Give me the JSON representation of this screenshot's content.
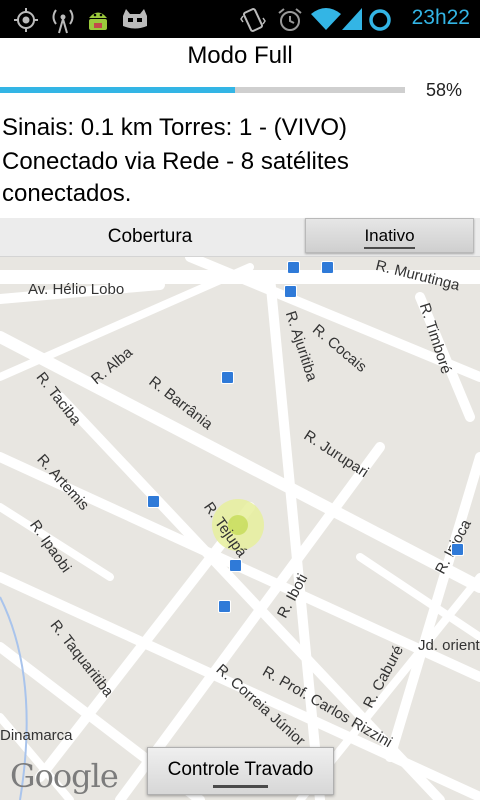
{
  "status_bar": {
    "time": "23h22",
    "left_icons": [
      "gps-icon",
      "radio-icon",
      "android-debug-icon",
      "cyanogen-icon"
    ],
    "right_icons": [
      "vibrate-icon",
      "alarm-icon",
      "wifi-icon",
      "signal-icon",
      "battery-ring-icon"
    ],
    "accent_color": "#33b5e5"
  },
  "header": {
    "title": "Modo Full",
    "progress_text": "58%",
    "progress_value": 0.58
  },
  "info": {
    "signals": "Sinais: 0.1 km Torres: 1 - (VIVO)",
    "connected": "Conectado via Rede - 8 satélites conectados."
  },
  "tabs": {
    "cobertura": "Cobertura",
    "inativo": "Inativo"
  },
  "map": {
    "streets": [
      "Av. Hélio Lobo",
      "R. Murutinga",
      "R. Alba",
      "R. Ajuritiba",
      "R. Cocais",
      "R. Timboré",
      "R. Taciba",
      "R. Barrânia",
      "R. Jurupari",
      "R. Artemis",
      "R. Tejupá",
      "R. Ipioca",
      "R. Ipaobi",
      "R. Iboti",
      "R. Caburé",
      "R. Taquaritiba",
      "Jd. orient",
      "R. Prof. Carlos Rizzini",
      "R. Correia Júnior",
      "Dinamarca"
    ],
    "logo": "Google"
  },
  "footer": {
    "button": "Controle Travado"
  }
}
